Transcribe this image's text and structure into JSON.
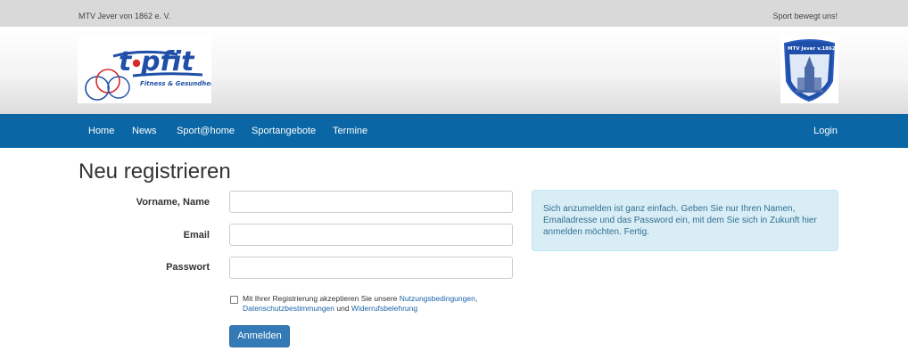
{
  "topbar": {
    "left_text": "MTV Jever von 1862 e. V.",
    "right_text": "Sport bewegt uns!"
  },
  "logos": {
    "left": {
      "wordmark": "topfit",
      "tagline": "Fitness & Gesundheit"
    },
    "right": {
      "text": "MTV Jever v.1862"
    }
  },
  "nav": {
    "items": [
      "Home",
      "News",
      "Sport@home",
      "Sportangebote",
      "Termine"
    ],
    "login": "Login"
  },
  "page": {
    "title": "Neu registrieren"
  },
  "form": {
    "name_label": "Vorname, Name",
    "email_label": "Email",
    "password_label": "Passwort",
    "name_value": "",
    "email_value": "",
    "password_value": "",
    "consent": {
      "checked": false,
      "prefix": "Mit Ihrer Registrierung akzeptieren Sie unsere ",
      "link1": "Nutzungsbedingungen",
      "sep1": ",",
      "link2": "Datenschutzbestimmungen",
      "between": " und ",
      "link3": "Widerrufsbelehrung"
    },
    "submit_label": "Anmelden"
  },
  "info": {
    "text": "Sich anzumelden ist ganz einfach. Geben Sie nur Ihren Namen, Emailadresse und das Password ein, mit dem Sie sich in Zukunft hier anmelden möchten. Fertig."
  },
  "colors": {
    "nav_bg": "#0a66a4",
    "topbar_bg": "#d9d9d9",
    "primary_button": "#337ab7",
    "info_bg": "#d9edf7",
    "info_text": "#31708f",
    "link": "#1a63a8"
  }
}
